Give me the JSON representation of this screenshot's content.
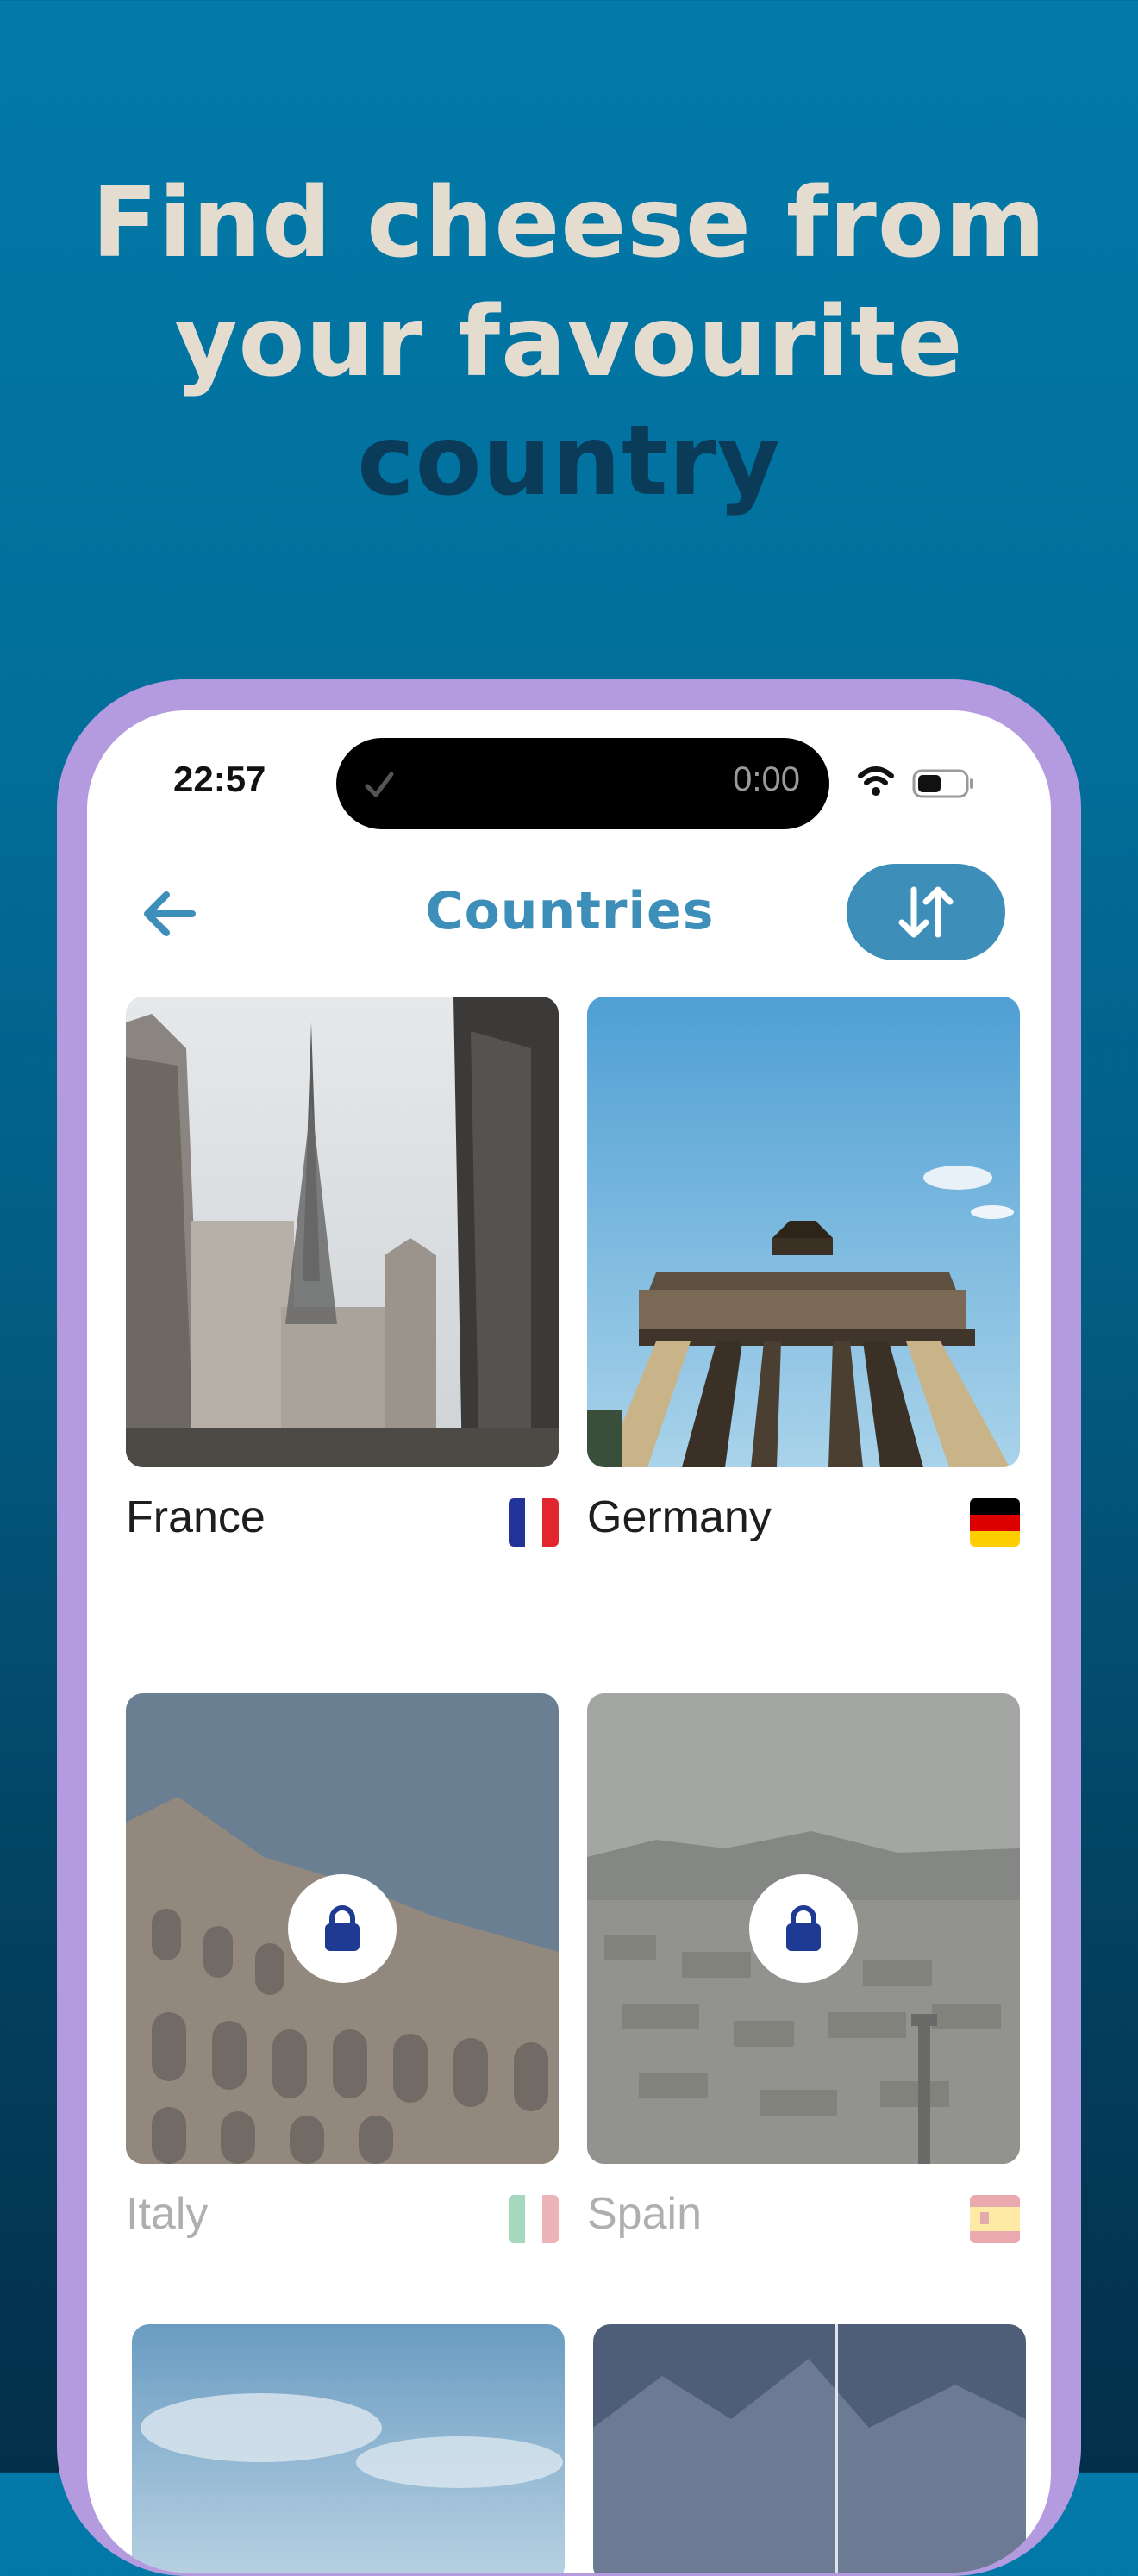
{
  "headline": {
    "line1": "Find cheese from",
    "line2": "your favourite",
    "line3": "country"
  },
  "status_bar": {
    "time": "22:57",
    "island_timer": "0:00"
  },
  "nav": {
    "title": "Countries"
  },
  "countries": [
    {
      "name": "France",
      "locked": false
    },
    {
      "name": "Germany",
      "locked": false
    },
    {
      "name": "Italy",
      "locked": true
    },
    {
      "name": "Spain",
      "locked": true
    }
  ],
  "colors": {
    "accent": "#3d8fba",
    "frame": "#b49be0",
    "headline": "#e3dccf",
    "headline_dark": "#0a3b58",
    "lock_icon": "#1f3a93"
  }
}
